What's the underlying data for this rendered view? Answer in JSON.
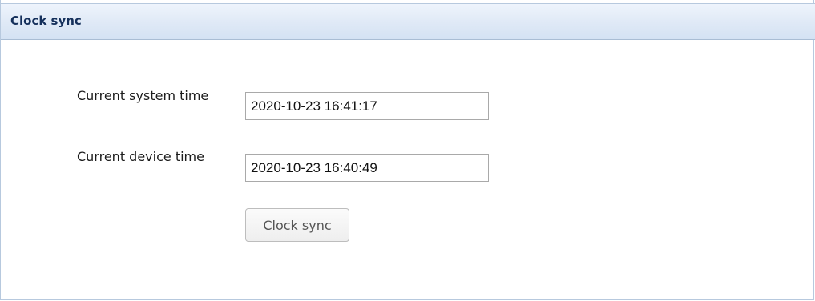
{
  "panel": {
    "title": "Clock sync"
  },
  "form": {
    "system_time": {
      "label": "Current system time",
      "value": "2020-10-23 16:41:17"
    },
    "device_time": {
      "label": "Current device time",
      "value": "2020-10-23 16:40:49"
    },
    "sync_button_label": "Clock sync"
  },
  "colors": {
    "header_text": "#15305b",
    "header_bg": "#dfe9f6",
    "border": "#b7c9de"
  }
}
